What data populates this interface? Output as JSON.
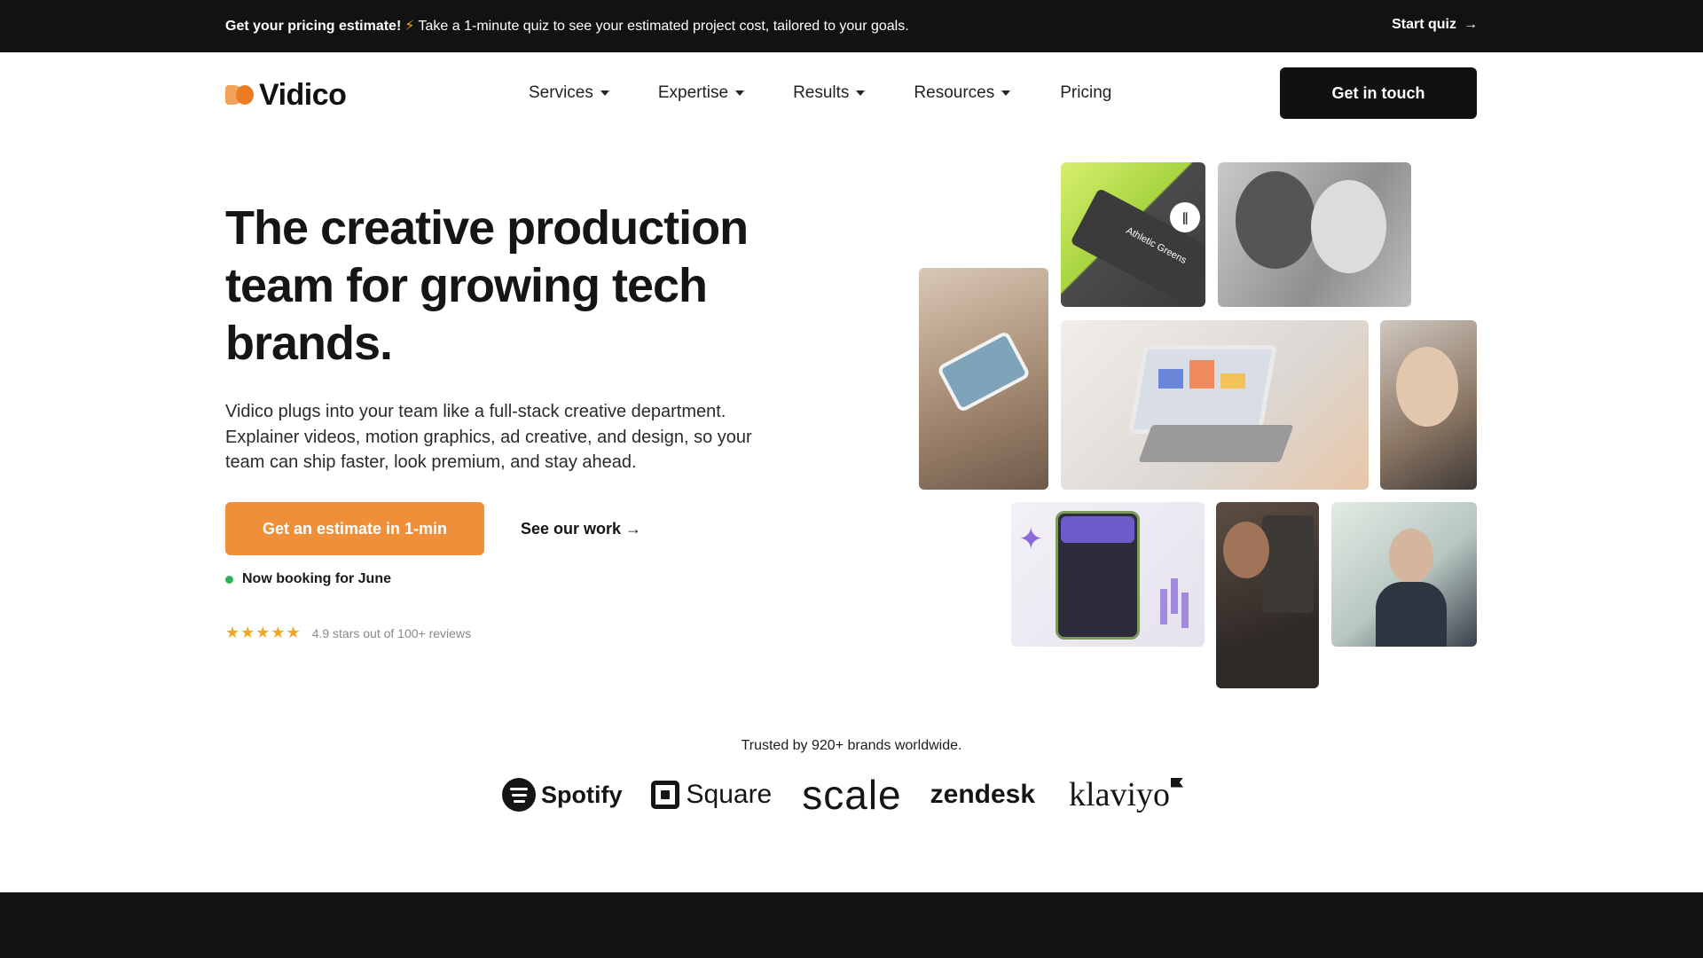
{
  "announcement": {
    "lead": "Get your pricing estimate!",
    "icon": "lightning-icon",
    "text": "Take a 1-minute quiz to see your estimated project cost, tailored to your goals.",
    "cta": "Start quiz",
    "cta_icon": "arrow-right-icon"
  },
  "nav": {
    "logo_text": "Vidico",
    "items": [
      {
        "label": "Services",
        "dropdown": true
      },
      {
        "label": "Expertise",
        "dropdown": true
      },
      {
        "label": "Results",
        "dropdown": true
      },
      {
        "label": "Resources",
        "dropdown": true
      },
      {
        "label": "Pricing",
        "dropdown": false
      }
    ],
    "cta": "Get in touch"
  },
  "hero": {
    "headline": "The creative production team for growing tech brands.",
    "subtext": "Vidico plugs into your team like a full-stack creative department. Explainer videos, motion graphics, ad creative, and design, so your team can ship faster, look premium, and stay ahead.",
    "primary_cta": "Get an estimate in 1-min",
    "secondary_cta": "See our work →",
    "booking": "Now booking for June",
    "stars": "★★★★★",
    "rating": "4.9 stars out of 100+ reviews"
  },
  "collage": {
    "tile1_label": "Athletic Greens"
  },
  "trusted": {
    "text": "Trusted by 920+ brands worldwide.",
    "logos": [
      "Spotify",
      "Square",
      "scale",
      "zendesk",
      "klaviyo"
    ]
  },
  "colors": {
    "accent": "#ef8f39",
    "dark": "#121212",
    "status_green": "#2fb457",
    "star": "#f4a623"
  }
}
